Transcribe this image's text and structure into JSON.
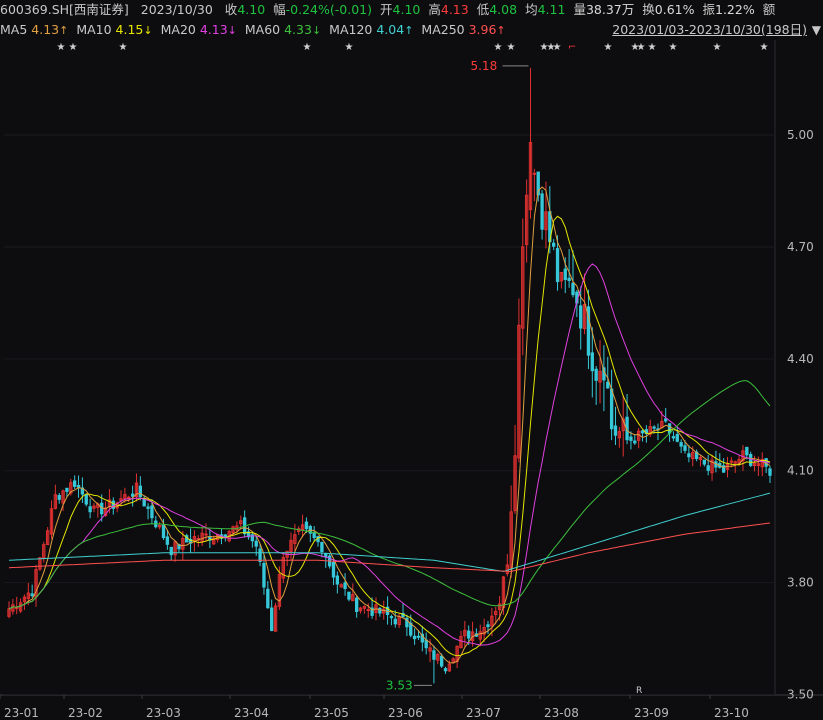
{
  "header": {
    "symbol": "600369.SH[西南证券]",
    "date": "2023/10/30",
    "quote": [
      {
        "label": "收",
        "value": "4.10",
        "tone": "down"
      },
      {
        "label": "幅",
        "value": "-0.24%(-0.01)",
        "tone": "down"
      },
      {
        "label": "开",
        "value": "4.10",
        "tone": "down"
      },
      {
        "label": "高",
        "value": "4.13",
        "tone": "up"
      },
      {
        "label": "低",
        "value": "4.08",
        "tone": "down"
      },
      {
        "label": "均",
        "value": "4.11",
        "tone": "down"
      },
      {
        "label": "量",
        "value": "38.37万",
        "tone": "flat"
      },
      {
        "label": "换",
        "value": "0.61%",
        "tone": "flat"
      },
      {
        "label": "振",
        "value": "1.22%",
        "tone": "flat"
      },
      {
        "label": "额",
        "value": "",
        "tone": "flat"
      }
    ]
  },
  "ma_legend": [
    {
      "name": "MA5",
      "value": "4.13",
      "arrow": "↑",
      "color": "#e0a040"
    },
    {
      "name": "MA10",
      "value": "4.15",
      "arrow": "↓",
      "color": "#e6e600"
    },
    {
      "name": "MA20",
      "value": "4.13",
      "arrow": "↓",
      "color": "#e040e0"
    },
    {
      "name": "MA60",
      "value": "4.33",
      "arrow": "↓",
      "color": "#3cc03c"
    },
    {
      "name": "MA120",
      "value": "4.04",
      "arrow": "↑",
      "color": "#40d0d0"
    },
    {
      "name": "MA250",
      "value": "3.96",
      "arrow": "↑",
      "color": "#ff5050"
    }
  ],
  "date_range": "2023/01/03-2023/10/30(198日)",
  "range_caret": "▼",
  "colors": {
    "up": "#ff3b3b",
    "down": "#1ec33f",
    "up_candle": "#e03030",
    "down_candle": "#36c8d8",
    "background": "#0d0d0f"
  },
  "chart_data": {
    "type": "candlestick",
    "y_ticks": [
      "5.00",
      "4.70",
      "4.40",
      "4.10",
      "3.80",
      "3.50"
    ],
    "ylim": [
      3.48,
      5.22
    ],
    "x_ticks": [
      "23-01",
      "23-02",
      "23-03",
      "23-04",
      "23-05",
      "23-06",
      "23-07",
      "23-08",
      "23-09",
      "23-10"
    ],
    "max_label": "5.18",
    "min_label": "3.53",
    "r_marker": "R",
    "event_star": "★",
    "event_flag": "⌐",
    "close_anchors": [
      {
        "t": 0,
        "v": 3.73
      },
      {
        "t": 6,
        "v": 3.78
      },
      {
        "t": 12,
        "v": 4.03
      },
      {
        "t": 17,
        "v": 4.07
      },
      {
        "t": 22,
        "v": 3.99
      },
      {
        "t": 27,
        "v": 4.01
      },
      {
        "t": 33,
        "v": 4.05
      },
      {
        "t": 37,
        "v": 3.98
      },
      {
        "t": 42,
        "v": 3.89
      },
      {
        "t": 48,
        "v": 3.92
      },
      {
        "t": 54,
        "v": 3.93
      },
      {
        "t": 60,
        "v": 3.95
      },
      {
        "t": 64,
        "v": 3.9
      },
      {
        "t": 68,
        "v": 3.68
      },
      {
        "t": 71,
        "v": 3.88
      },
      {
        "t": 76,
        "v": 3.94
      },
      {
        "t": 81,
        "v": 3.9
      },
      {
        "t": 85,
        "v": 3.8
      },
      {
        "t": 90,
        "v": 3.74
      },
      {
        "t": 96,
        "v": 3.72
      },
      {
        "t": 103,
        "v": 3.69
      },
      {
        "t": 108,
        "v": 3.62
      },
      {
        "t": 113,
        "v": 3.58
      },
      {
        "t": 118,
        "v": 3.66
      },
      {
        "t": 123,
        "v": 3.68
      },
      {
        "t": 127,
        "v": 3.75
      },
      {
        "t": 129,
        "v": 3.86
      },
      {
        "t": 131,
        "v": 4.2
      },
      {
        "t": 133,
        "v": 4.75
      },
      {
        "t": 135,
        "v": 4.95
      },
      {
        "t": 137,
        "v": 4.85
      },
      {
        "t": 140,
        "v": 4.72
      },
      {
        "t": 143,
        "v": 4.58
      },
      {
        "t": 146,
        "v": 4.6
      },
      {
        "t": 149,
        "v": 4.5
      },
      {
        "t": 152,
        "v": 4.38
      },
      {
        "t": 154,
        "v": 4.4
      },
      {
        "t": 156,
        "v": 4.22
      },
      {
        "t": 160,
        "v": 4.18
      },
      {
        "t": 165,
        "v": 4.2
      },
      {
        "t": 170,
        "v": 4.22
      },
      {
        "t": 175,
        "v": 4.14
      },
      {
        "t": 180,
        "v": 4.12
      },
      {
        "t": 185,
        "v": 4.1
      },
      {
        "t": 190,
        "v": 4.14
      },
      {
        "t": 194,
        "v": 4.12
      },
      {
        "t": 197,
        "v": 4.1
      }
    ],
    "ma120_anchors": [
      {
        "t": 0,
        "v": 3.86
      },
      {
        "t": 40,
        "v": 3.88
      },
      {
        "t": 80,
        "v": 3.88
      },
      {
        "t": 110,
        "v": 3.86
      },
      {
        "t": 128,
        "v": 3.83
      },
      {
        "t": 150,
        "v": 3.9
      },
      {
        "t": 175,
        "v": 3.98
      },
      {
        "t": 197,
        "v": 4.04
      }
    ],
    "ma250_anchors": [
      {
        "t": 0,
        "v": 3.84
      },
      {
        "t": 40,
        "v": 3.86
      },
      {
        "t": 80,
        "v": 3.86
      },
      {
        "t": 110,
        "v": 3.84
      },
      {
        "t": 130,
        "v": 3.83
      },
      {
        "t": 150,
        "v": 3.88
      },
      {
        "t": 175,
        "v": 3.93
      },
      {
        "t": 197,
        "v": 3.96
      }
    ]
  }
}
